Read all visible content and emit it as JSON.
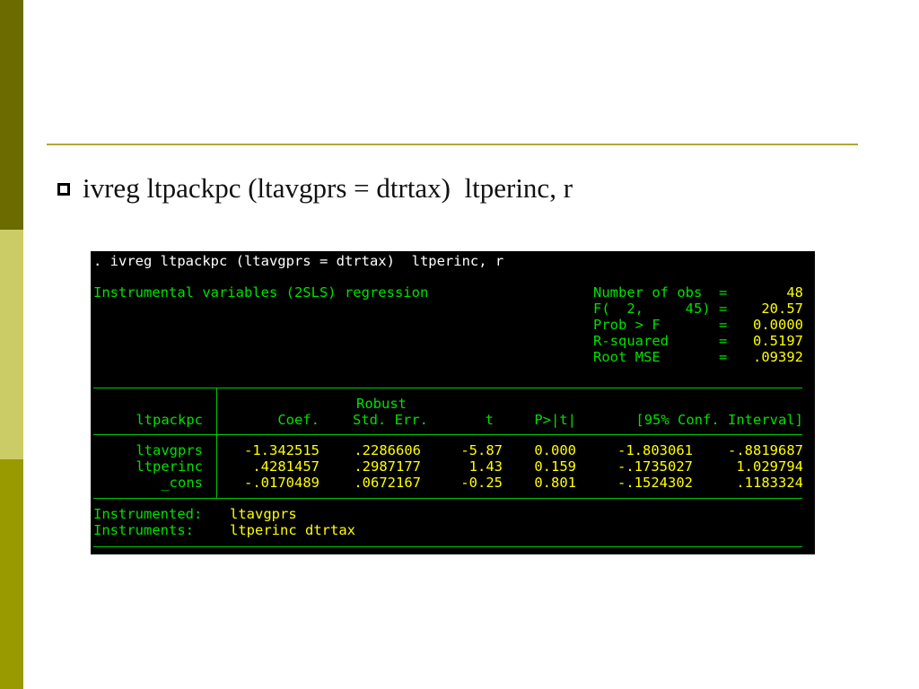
{
  "slide": {
    "bullet_text": "ivreg ltpackpc (ltavgprs = dtrtax)  ltperinc, r"
  },
  "console": {
    "command": ". ivreg ltpackpc (ltavgprs = dtrtax)  ltperinc, r",
    "regression_title": "Instrumental variables (2SLS) regression",
    "stats": [
      {
        "label": "Number of obs",
        "eq": "=",
        "value": "48"
      },
      {
        "label": "F(  2,     45)",
        "eq": "=",
        "value": "20.57"
      },
      {
        "label": "Prob > F",
        "eq": "=",
        "value": "0.0000"
      },
      {
        "label": "R-squared",
        "eq": "=",
        "value": "0.5197"
      },
      {
        "label": "Root MSE",
        "eq": "=",
        "value": ".09392"
      }
    ],
    "header": {
      "depvar": "ltpackpc",
      "robust": "Robust",
      "coef": "Coef.",
      "stderr": "Std. Err.",
      "t": "t",
      "p": "P>|t|",
      "ci": "[95% Conf. Interval]"
    },
    "rows": [
      {
        "var": "ltavgprs",
        "coef": "-1.342515",
        "se": ".2286606",
        "t": "-5.87",
        "p": "0.000",
        "lo": "-1.803061",
        "hi": "-.8819687"
      },
      {
        "var": "ltperinc",
        "coef": ".4281457",
        "se": ".2987177",
        "t": "1.43",
        "p": "0.159",
        "lo": "-.1735027",
        "hi": "1.029794"
      },
      {
        "var": "_cons",
        "coef": "-.0170489",
        "se": ".0672167",
        "t": "-0.25",
        "p": "0.801",
        "lo": "-.1524302",
        "hi": ".1183324"
      }
    ],
    "instrumented_label": "Instrumented:",
    "instrumented_value": "ltavgprs",
    "instruments_label": "Instruments:",
    "instruments_value": "ltperinc dtrtax"
  }
}
